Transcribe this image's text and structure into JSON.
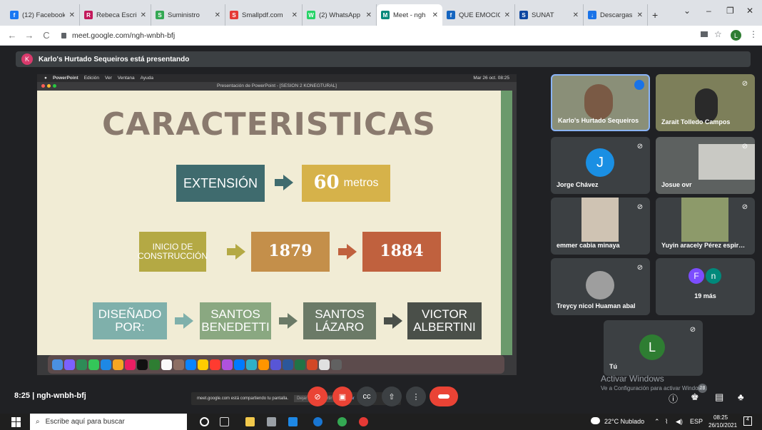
{
  "browser": {
    "tabs": [
      {
        "label": "(12) Facebook",
        "color": "#1877f2",
        "glyph": "f"
      },
      {
        "label": "Rebeca Escribe",
        "color": "#c2185b",
        "glyph": "R"
      },
      {
        "label": "Suministro",
        "color": "#34a853",
        "glyph": "S"
      },
      {
        "label": "Smallpdf.com",
        "color": "#e53935",
        "glyph": "S"
      },
      {
        "label": "(2) WhatsApp",
        "color": "#25d366",
        "glyph": "W"
      },
      {
        "label": "Meet - ngh",
        "color": "#00897b",
        "glyph": "M"
      },
      {
        "label": "QUE EMOCION",
        "color": "#1565c0",
        "glyph": "f"
      },
      {
        "label": "SUNAT",
        "color": "#0d47a1",
        "glyph": "S"
      },
      {
        "label": "Descargas",
        "color": "#1a73e8",
        "glyph": "↓"
      }
    ],
    "url": "meet.google.com/ngh-wnbh-bfj",
    "profile_initial": "L"
  },
  "meet": {
    "presenting_initial": "K",
    "presenting_text": "Karlo's Hurtado Sequeiros está presentando",
    "meeting_code": "8:25  |  ngh-wnbh-bfj",
    "participants": [
      {
        "name": "Karlo's Hurtado Sequeiros",
        "type": "video",
        "speaking": true
      },
      {
        "name": "Zarait Tolledo Campos",
        "type": "video"
      },
      {
        "name": "Jorge Chávez",
        "type": "avatar",
        "initial": "J",
        "color": "#1a8fe3"
      },
      {
        "name": "Josue ovr",
        "type": "video"
      },
      {
        "name": "emmer cabia minaya",
        "type": "video"
      },
      {
        "name": "Yuyin aracely Pérez espir…",
        "type": "video"
      },
      {
        "name": "Treycy nicol Huaman abal",
        "type": "video"
      },
      {
        "name": "19 más",
        "type": "more",
        "initials": [
          "F",
          "n"
        ]
      },
      {
        "name": "Tú",
        "type": "avatar",
        "initial": "L",
        "color": "#2e7d32"
      }
    ],
    "participant_count": "28",
    "activate_windows": "Activar Windows",
    "activate_windows_sub": "Ve a Configuración para activar Windows."
  },
  "shared_screen": {
    "mac_menu": [
      "PowerPoint",
      "Edición",
      "Ver",
      "Ventana",
      "Ayuda"
    ],
    "mac_clock": "Mar 26 oct. 08:25",
    "window_title": "Presentación de PowerPoint - [SESION 2 KONEGTURAL]",
    "slide": {
      "title": "CARACTERISTICAS",
      "row1": {
        "label": "EXTENSIÓN",
        "value": "60",
        "unit": "metros"
      },
      "row2": {
        "label": "INICIO DE CONSTRUCCIÓN",
        "year1": "1879",
        "year2": "1884"
      },
      "row3": {
        "label": "DISEÑADO POR:",
        "name1": "SANTOS BENEDETTI",
        "name2": "SANTOS LÁZARO",
        "name3": "VICTOR ALBERTINI"
      }
    },
    "share_notice": "meet.google.com está compartiendo tu pantalla.",
    "share_stop": "Dejar de compartir",
    "share_hide": "Ocultar"
  },
  "taskbar": {
    "search_placeholder": "Escribe aquí para buscar",
    "weather": "22°C  Nublado",
    "lang": "ESP",
    "time": "08:25",
    "date": "26/10/2021",
    "notif_count": "4"
  }
}
